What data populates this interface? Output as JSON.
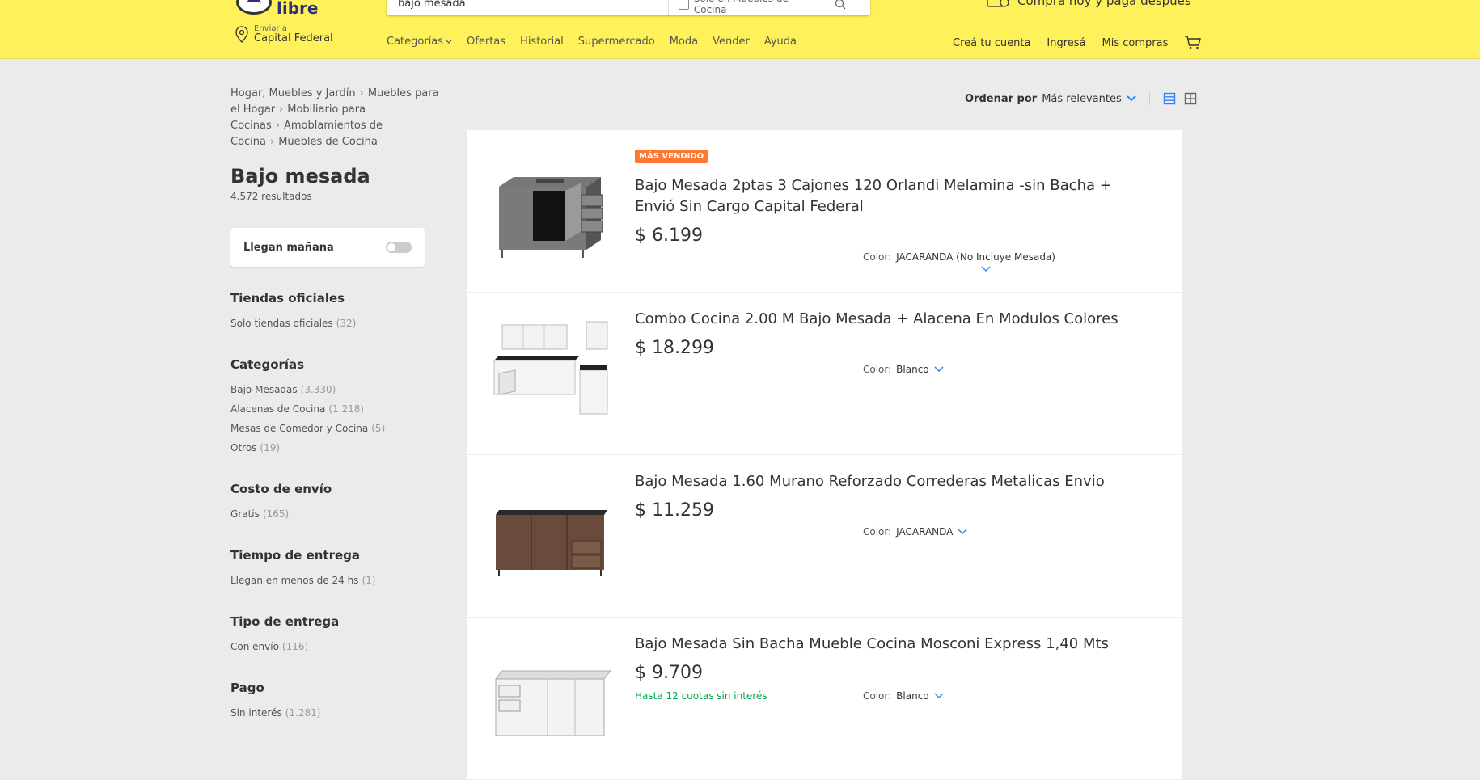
{
  "header": {
    "logo_text": "libre",
    "search": {
      "value": "bajo mesada",
      "scope_label": "Solo en Muebles de Cocina"
    },
    "promo": "Comprá hoy y pagá después",
    "location": {
      "small": "Enviar a",
      "big": "Capital Federal"
    },
    "nav": [
      "Categorías",
      "Ofertas",
      "Historial",
      "Supermercado",
      "Moda",
      "Vender",
      "Ayuda"
    ],
    "account": [
      "Creá tu cuenta",
      "Ingresá",
      "Mis compras"
    ]
  },
  "sidebar": {
    "breadcrumb": [
      "Hogar, Muebles y Jardín",
      "Muebles para el Hogar",
      "Mobiliario para Cocinas",
      "Amoblamientos de Cocina",
      "Muebles de Cocina"
    ],
    "title": "Bajo mesada",
    "results": "4.572 resultados",
    "tomorrow_label": "Llegan mañana",
    "filters": [
      {
        "title": "Tiendas oficiales",
        "options": [
          {
            "label": "Solo tiendas oficiales",
            "count": "(32)"
          }
        ]
      },
      {
        "title": "Categorías",
        "options": [
          {
            "label": "Bajo Mesadas",
            "count": "(3.330)"
          },
          {
            "label": "Alacenas de Cocina",
            "count": "(1.218)"
          },
          {
            "label": "Mesas de Comedor y Cocina",
            "count": "(5)"
          },
          {
            "label": "Otros",
            "count": "(19)"
          }
        ]
      },
      {
        "title": "Costo de envío",
        "options": [
          {
            "label": "Gratis",
            "count": "(165)"
          }
        ]
      },
      {
        "title": "Tiempo de entrega",
        "options": [
          {
            "label": "Llegan en menos de 24 hs",
            "count": "(1)"
          }
        ]
      },
      {
        "title": "Tipo de entrega",
        "options": [
          {
            "label": "Con envío",
            "count": "(116)"
          }
        ]
      },
      {
        "title": "Pago",
        "options": [
          {
            "label": "Sin interés",
            "count": "(1.281)"
          }
        ]
      }
    ]
  },
  "sort": {
    "label": "Ordenar por",
    "value": "Más relevantes"
  },
  "items": [
    {
      "badge": "MÁS VENDIDO",
      "title": "Bajo Mesada 2ptas 3 Cajones 120 Orlandi Melamina -sin Bacha + Envió Sin Cargo Capital Federal",
      "price": "$ 6.199",
      "color_label": "Color:",
      "color_value": "JACARANDA (No Incluye Mesada)"
    },
    {
      "title": "Combo Cocina 2.00 M Bajo Mesada + Alacena En Modulos Colores",
      "price": "$ 18.299",
      "color_label": "Color:",
      "color_value": "Blanco"
    },
    {
      "title": "Bajo Mesada 1.60 Murano Reforzado Correderas Metalicas Envio",
      "price": "$ 11.259",
      "color_label": "Color:",
      "color_value": "JACARANDA"
    },
    {
      "title": "Bajo Mesada Sin Bacha Mueble Cocina Mosconi Express 1,40 Mts",
      "price": "$ 9.709",
      "installments": "Hasta 12 cuotas sin interés",
      "color_label": "Color:",
      "color_value": "Blanco"
    }
  ],
  "colors": {
    "header_bg": "#fff159",
    "page_bg": "#ebebeb",
    "badge": "#ff7733",
    "link_blue": "#3483fa",
    "green": "#00a650"
  }
}
